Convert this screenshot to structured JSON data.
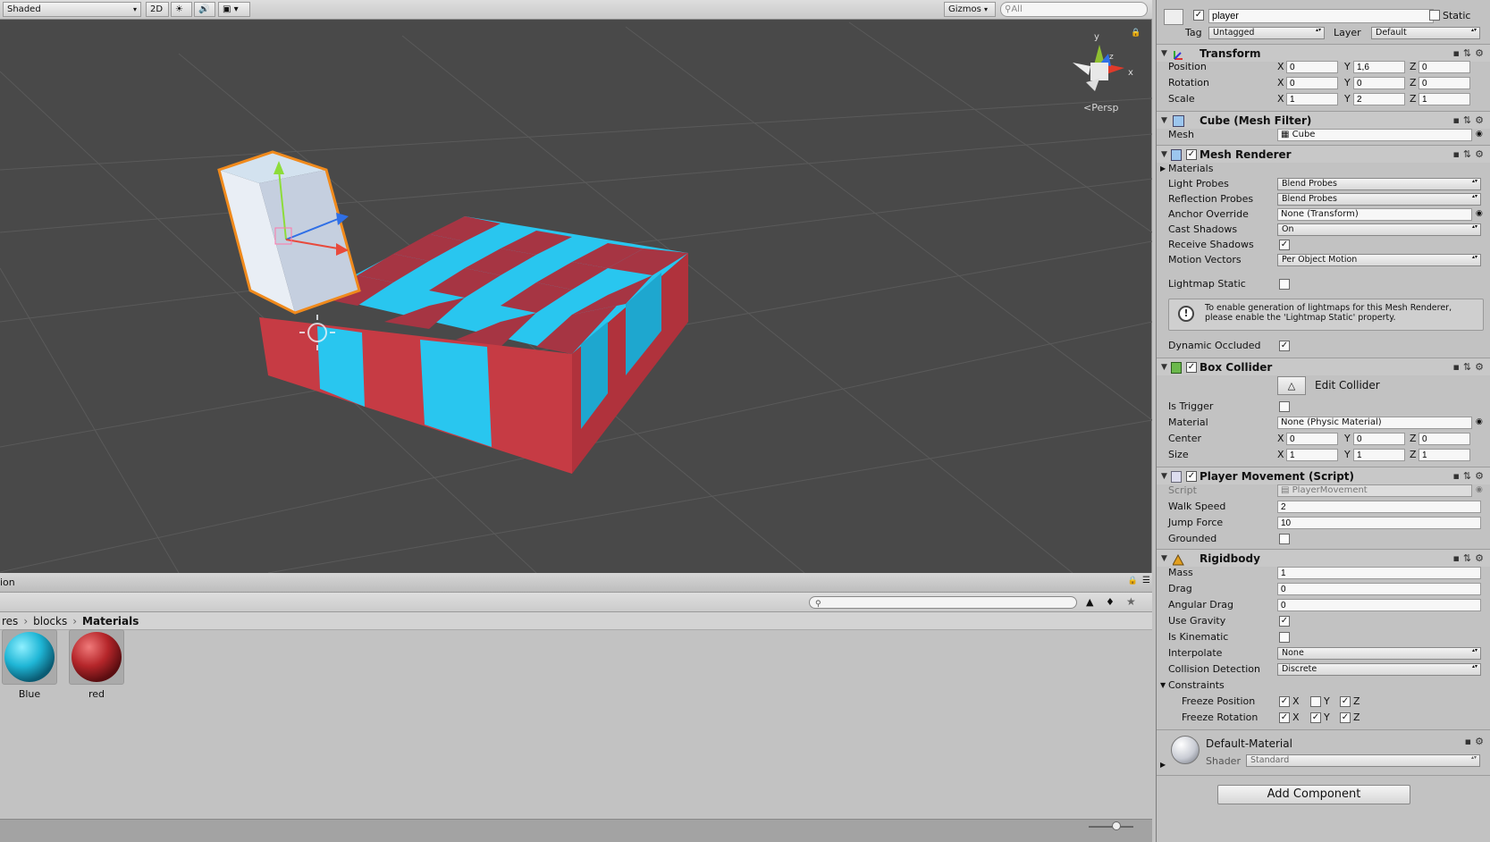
{
  "scene_view": {
    "shading_mode": "Shaded",
    "mode_2d": "2D",
    "gizmos_label": "Gizmos",
    "search_placeholder": "All",
    "projection_label": "Persp",
    "axis_labels": {
      "x": "x",
      "y": "y",
      "z": "z"
    }
  },
  "project": {
    "tab_label": "ion",
    "breadcrumb": [
      "res",
      "blocks",
      "Materials"
    ],
    "assets": [
      {
        "name": "Blue",
        "color": "#1fb6d6"
      },
      {
        "name": "red",
        "color": "#b5262a"
      }
    ]
  },
  "inspector": {
    "object_name": "player",
    "active": true,
    "static_label": "Static",
    "static": false,
    "tag_label": "Tag",
    "tag_value": "Untagged",
    "layer_label": "Layer",
    "layer_value": "Default",
    "transform": {
      "title": "Transform",
      "position_label": "Position",
      "rotation_label": "Rotation",
      "scale_label": "Scale",
      "position": {
        "x": "0",
        "y": "1,6",
        "z": "0"
      },
      "rotation": {
        "x": "0",
        "y": "0",
        "z": "0"
      },
      "scale": {
        "x": "1",
        "y": "2",
        "z": "1"
      }
    },
    "mesh_filter": {
      "title": "Cube (Mesh Filter)",
      "mesh_label": "Mesh",
      "mesh_value": "Cube"
    },
    "mesh_renderer": {
      "title": "Mesh Renderer",
      "materials_label": "Materials",
      "light_probes_label": "Light Probes",
      "light_probes_value": "Blend Probes",
      "reflection_probes_label": "Reflection Probes",
      "reflection_probes_value": "Blend Probes",
      "anchor_override_label": "Anchor Override",
      "anchor_override_value": "None (Transform)",
      "cast_shadows_label": "Cast Shadows",
      "cast_shadows_value": "On",
      "receive_shadows_label": "Receive Shadows",
      "motion_vectors_label": "Motion Vectors",
      "motion_vectors_value": "Per Object Motion",
      "lightmap_static_label": "Lightmap Static",
      "warning_line1": "To enable generation of lightmaps for this Mesh Renderer,",
      "warning_line2": "please enable the 'Lightmap Static' property.",
      "dynamic_occluded_label": "Dynamic Occluded"
    },
    "box_collider": {
      "title": "Box Collider",
      "edit_collider_label": "Edit Collider",
      "is_trigger_label": "Is Trigger",
      "material_label": "Material",
      "material_value": "None (Physic Material)",
      "center_label": "Center",
      "size_label": "Size",
      "center": {
        "x": "0",
        "y": "0",
        "z": "0"
      },
      "size": {
        "x": "1",
        "y": "1",
        "z": "1"
      }
    },
    "player_movement": {
      "title": "Player Movement (Script)",
      "script_label": "Script",
      "script_value": "PlayerMovement",
      "walk_speed_label": "Walk Speed",
      "walk_speed_value": "2",
      "jump_force_label": "Jump Force",
      "jump_force_value": "10",
      "grounded_label": "Grounded"
    },
    "rigidbody": {
      "title": "Rigidbody",
      "mass_label": "Mass",
      "mass_value": "1",
      "drag_label": "Drag",
      "drag_value": "0",
      "angular_drag_label": "Angular Drag",
      "angular_drag_value": "0",
      "use_gravity_label": "Use Gravity",
      "is_kinematic_label": "Is Kinematic",
      "interpolate_label": "Interpolate",
      "interpolate_value": "None",
      "collision_detection_label": "Collision Detection",
      "collision_detection_value": "Discrete",
      "constraints_label": "Constraints",
      "freeze_position_label": "Freeze Position",
      "freeze_rotation_label": "Freeze Rotation",
      "axis_x": "X",
      "axis_y": "Y",
      "axis_z": "Z"
    },
    "material": {
      "name": "Default-Material",
      "shader_label": "Shader",
      "shader_value": "Standard"
    },
    "add_component_label": "Add Component"
  },
  "colors": {
    "scene_bg": "#494949",
    "cyan": "#29c6ef",
    "red": "#c63b44",
    "selection": "#f08a1c"
  }
}
